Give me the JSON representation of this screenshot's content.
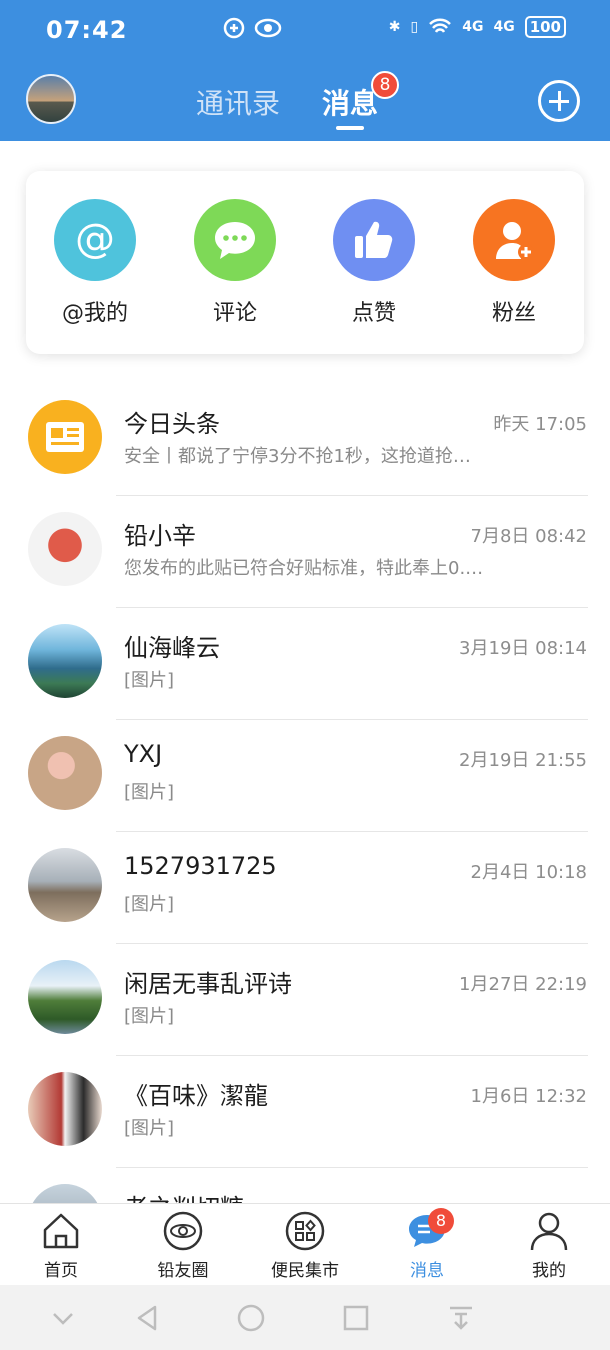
{
  "status_bar": {
    "time": "07:42",
    "network_1": "4G",
    "network_2": "4G",
    "battery": "100"
  },
  "header": {
    "tabs": [
      {
        "label": "通讯录",
        "active": false
      },
      {
        "label": "消息",
        "active": true,
        "badge": "8"
      }
    ],
    "accent_color": "#3d8fe0",
    "badge_color": "#f04c3a"
  },
  "quick_actions": [
    {
      "label": "@我的",
      "icon": "at-icon",
      "color": "#4fc3dc"
    },
    {
      "label": "评论",
      "icon": "comment-icon",
      "color": "#7ed957"
    },
    {
      "label": "点赞",
      "icon": "thumbs-up-icon",
      "color": "#6f8ff2"
    },
    {
      "label": "粉丝",
      "icon": "add-user-icon",
      "color": "#f77421"
    }
  ],
  "messages": [
    {
      "name": "今日头条",
      "time": "昨天 17:05",
      "preview": "安全丨都说了宁停3分不抢1秒，这抢道抢…"
    },
    {
      "name": "铅小辛",
      "time": "7月8日 08:42",
      "preview": "您发布的此贴已符合好贴标准，特此奉上0.…"
    },
    {
      "name": "仙海峰云",
      "time": "3月19日 08:14",
      "preview": "[图片]"
    },
    {
      "name": "YXJ",
      "time": "2月19日 21:55",
      "preview": "[图片]"
    },
    {
      "name": "1527931725",
      "time": "2月4日 10:18",
      "preview": "[图片]"
    },
    {
      "name": "闲居无事乱评诗",
      "time": "1月27日 22:19",
      "preview": "[图片]"
    },
    {
      "name": "《百味》潔龍",
      "time": "1月6日 12:32",
      "preview": "[图片]"
    },
    {
      "name": "老之判切糖",
      "time": "",
      "preview": ""
    }
  ],
  "bottom_nav": [
    {
      "label": "首页",
      "icon": "home-icon"
    },
    {
      "label": "铅友圈",
      "icon": "circle-icon"
    },
    {
      "label": "便民集市",
      "icon": "market-icon"
    },
    {
      "label": "消息",
      "icon": "message-icon",
      "active": true,
      "badge": "8"
    },
    {
      "label": "我的",
      "icon": "profile-icon"
    }
  ]
}
